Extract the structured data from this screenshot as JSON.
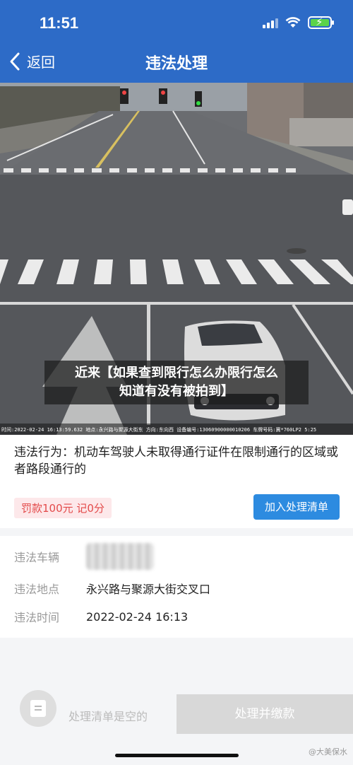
{
  "status_bar": {
    "time": "11:51"
  },
  "nav": {
    "back_label": "返回",
    "title": "违法处理"
  },
  "photo": {
    "caption_line1": "近来【如果查到限行怎么办限行怎么",
    "caption_line2": "知道有没有被拍到】",
    "info_strip": "时间:2022-02-24 16:13:59.632  地点:永兴路与聚源大街东  方向:东向西  设备编号:13060900000010206  车牌号码:冀*760LP2  5:25"
  },
  "violation": {
    "behavior": "违法行为：机动车驾驶人未取得通行证件在限制通行的区域或者路段通行的",
    "fine": "罚款100元  记0分",
    "add_button": "加入处理清单"
  },
  "details": {
    "vehicle_label": "违法车辆",
    "location_label": "违法地点",
    "location_value": "永兴路与聚源大街交叉口",
    "time_label": "违法时间",
    "time_value": "2022-02-24 16:13"
  },
  "bottom": {
    "empty_text": "处理清单是空的",
    "pay_button": "处理并缴款"
  },
  "watermark": "@大美保水",
  "colors": {
    "nav_blue": "#2d6bc7",
    "button_blue": "#2d8be0",
    "fine_red": "#e34a4a"
  }
}
